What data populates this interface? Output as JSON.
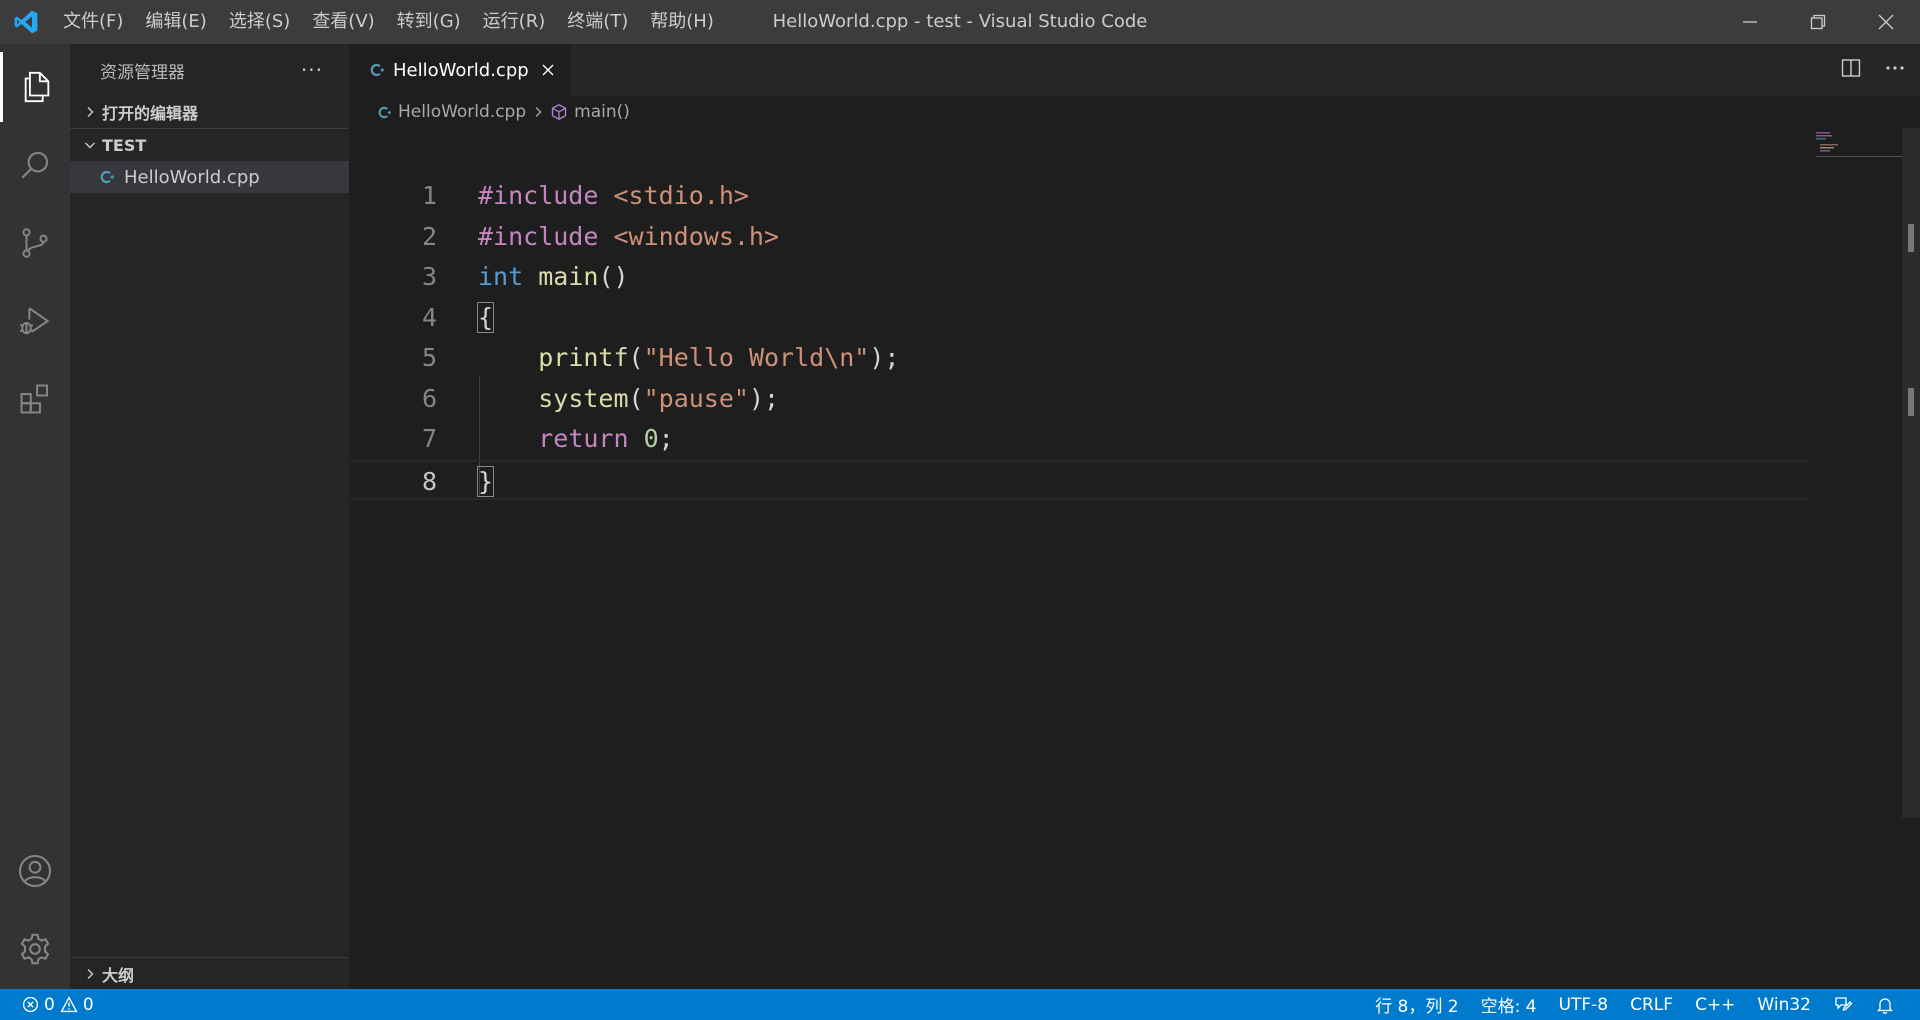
{
  "window": {
    "title": "HelloWorld.cpp - test - Visual Studio Code",
    "menu": [
      "文件(F)",
      "编辑(E)",
      "选择(S)",
      "查看(V)",
      "转到(G)",
      "运行(R)",
      "终端(T)",
      "帮助(H)"
    ],
    "controls": [
      "minimize-icon",
      "restore-icon",
      "close-icon"
    ]
  },
  "activity_bar": {
    "top": [
      "files-icon",
      "search-icon",
      "source-control-icon",
      "run-debug-icon",
      "extensions-icon"
    ],
    "bottom": [
      "account-icon",
      "gear-icon"
    ],
    "active": "files-icon"
  },
  "sidebar": {
    "title": "资源管理器",
    "more": "···",
    "open_editors": "打开的编辑器",
    "folder": "TEST",
    "files": [
      {
        "name": "HelloWorld.cpp",
        "icon": "cpp-file-icon"
      }
    ],
    "outline": "大纲"
  },
  "editor": {
    "tab": {
      "label": "HelloWorld.cpp",
      "icon": "cpp-file-icon"
    },
    "breadcrumb": {
      "file": "HelloWorld.cpp",
      "symbol": "main()"
    },
    "lines": [
      {
        "num": "1",
        "tokens": [
          {
            "t": "#include ",
            "c": "pp"
          },
          {
            "t": "<stdio.h>",
            "c": "inc"
          }
        ]
      },
      {
        "num": "2",
        "tokens": [
          {
            "t": "#include ",
            "c": "pp"
          },
          {
            "t": "<windows.h>",
            "c": "inc"
          }
        ]
      },
      {
        "num": "3",
        "tokens": [
          {
            "t": "int",
            "c": "kw"
          },
          {
            "t": " ",
            "c": ""
          },
          {
            "t": "main",
            "c": "fn"
          },
          {
            "t": "()",
            "c": ""
          }
        ]
      },
      {
        "num": "4",
        "tokens": [
          {
            "t": "{",
            "c": "bracket"
          }
        ]
      },
      {
        "num": "5",
        "tokens": [
          {
            "t": "    ",
            "c": ""
          },
          {
            "t": "printf",
            "c": "fn"
          },
          {
            "t": "(",
            "c": ""
          },
          {
            "t": "\"Hello World\\n\"",
            "c": "str"
          },
          {
            "t": ");",
            "c": ""
          }
        ]
      },
      {
        "num": "6",
        "tokens": [
          {
            "t": "    ",
            "c": ""
          },
          {
            "t": "system",
            "c": "fn"
          },
          {
            "t": "(",
            "c": ""
          },
          {
            "t": "\"pause\"",
            "c": "str"
          },
          {
            "t": ");",
            "c": ""
          }
        ]
      },
      {
        "num": "7",
        "tokens": [
          {
            "t": "    ",
            "c": ""
          },
          {
            "t": "return",
            "c": "ctl"
          },
          {
            "t": " ",
            "c": ""
          },
          {
            "t": "0",
            "c": "num"
          },
          {
            "t": ";",
            "c": ""
          }
        ]
      },
      {
        "num": "8",
        "tokens": [
          {
            "t": "}",
            "c": "bracket"
          }
        ]
      }
    ],
    "current_line": "8"
  },
  "status_bar": {
    "errors": "0",
    "warnings": "0",
    "position": "行 8，列 2",
    "indent": "空格: 4",
    "encoding": "UTF-8",
    "eol": "CRLF",
    "language": "C++",
    "platform": "Win32"
  },
  "colors": {
    "accent": "#007acc",
    "titlebar": "#3c3c3c",
    "activitybar": "#333333",
    "sidebar": "#252526",
    "editor": "#1e1e1e",
    "logo": "#23a9f2",
    "cpp_icon": "#519aba"
  }
}
